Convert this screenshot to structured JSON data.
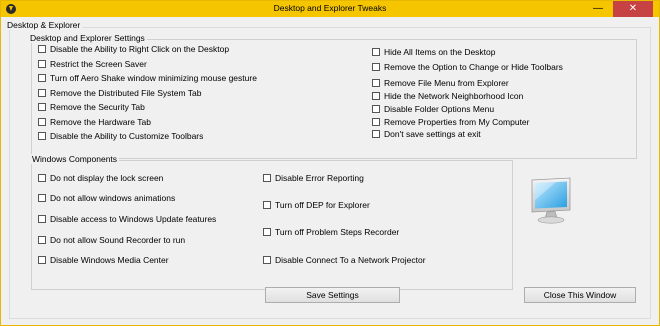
{
  "window": {
    "title": "Desktop and Explorer Tweaks",
    "minimize_glyph": "—",
    "close_glyph": "✕"
  },
  "main_group": {
    "label": "Desktop & Explorer"
  },
  "settings_group": {
    "label": "Desktop and Explorer Settings",
    "left_items": [
      "Disable the Ability to Right Click on the Desktop",
      "Restrict the Screen Saver",
      "Turn off Aero Shake window minimizing mouse gesture",
      "Remove the Distributed File System Tab",
      "Remove the Security Tab",
      "Remove the Hardware Tab",
      "Disable the Ability to Customize Toolbars"
    ],
    "right_items": [
      "Hide All Items on the Desktop",
      "Remove the Option to Change or Hide Toolbars",
      "Remove File Menu from Explorer",
      "Hide the Network Neighborhood Icon",
      "Disable Folder Options Menu",
      "Remove Properties from My Computer",
      "Don't save settings at exit"
    ]
  },
  "components_group": {
    "label": "Windows Components",
    "left_items": [
      "Do not display the lock screen",
      "Do not allow windows animations",
      "Disable access to Windows Update features",
      "Do not allow Sound Recorder to run",
      "Disable Windows Media Center"
    ],
    "right_items": [
      "Disable Error Reporting",
      "Turn off DEP for Explorer",
      "Turn off Problem Steps Recorder",
      "Disable Connect To a Network Projector"
    ]
  },
  "buttons": {
    "save": "Save Settings",
    "close": "Close This Window"
  },
  "icons": {
    "app": "tweaks-app-icon",
    "monitor": "monitor-icon"
  }
}
